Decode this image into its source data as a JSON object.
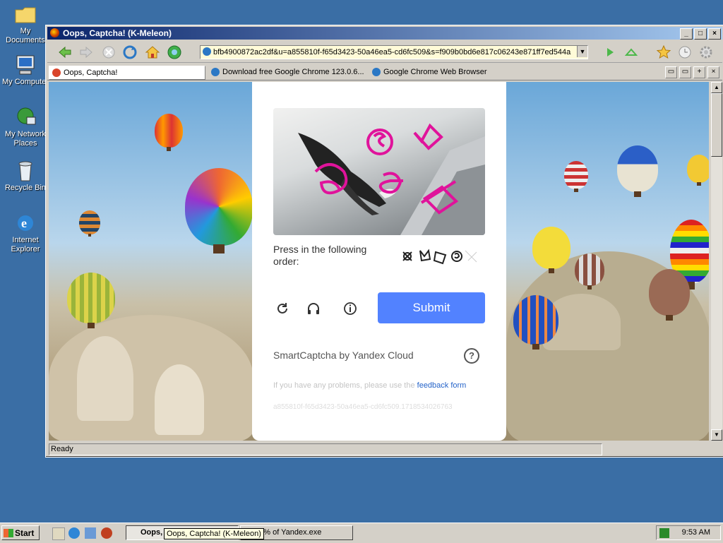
{
  "desktop": {
    "icons": [
      {
        "label": "My Documents"
      },
      {
        "label": "My Computer"
      },
      {
        "label": "My Network Places"
      },
      {
        "label": "Recycle Bin"
      },
      {
        "label": "Internet Explorer"
      }
    ]
  },
  "window": {
    "title": "Oops, Captcha! (K-Meleon)",
    "url": "bfb4900872ac2df&u=a855810f-f65d3423-50a46ea5-cd6fc509&s=f909b0bd6e817c06243e871ff7ed544a",
    "tabs": [
      {
        "label": "Oops, Captcha!"
      },
      {
        "label": "Download free Google Chrome 123.0.6..."
      },
      {
        "label": "Google Chrome Web Browser"
      }
    ],
    "status": "Ready"
  },
  "captcha": {
    "instruction": "Press in the following order:",
    "submit_label": "Submit",
    "brand": "SmartCaptcha by Yandex Cloud",
    "help_glyph": "?",
    "problems_text": "If you have any problems, please use the",
    "problems_link": "feedback form",
    "token": "a855810f-f65d3423-50a46ea5-cd6fc509.1718534026763",
    "accent": "#5282ff",
    "marker_color": "#e0139b"
  },
  "taskbar": {
    "start_label": "Start",
    "task_active": "Oops, Captcha! (K-Meleon)",
    "task_active_short": "Oops,",
    "task_second": "00% of Yandex.exe",
    "tooltip": "Oops, Captcha! (K-Meleon)",
    "clock": "9:53 AM"
  }
}
